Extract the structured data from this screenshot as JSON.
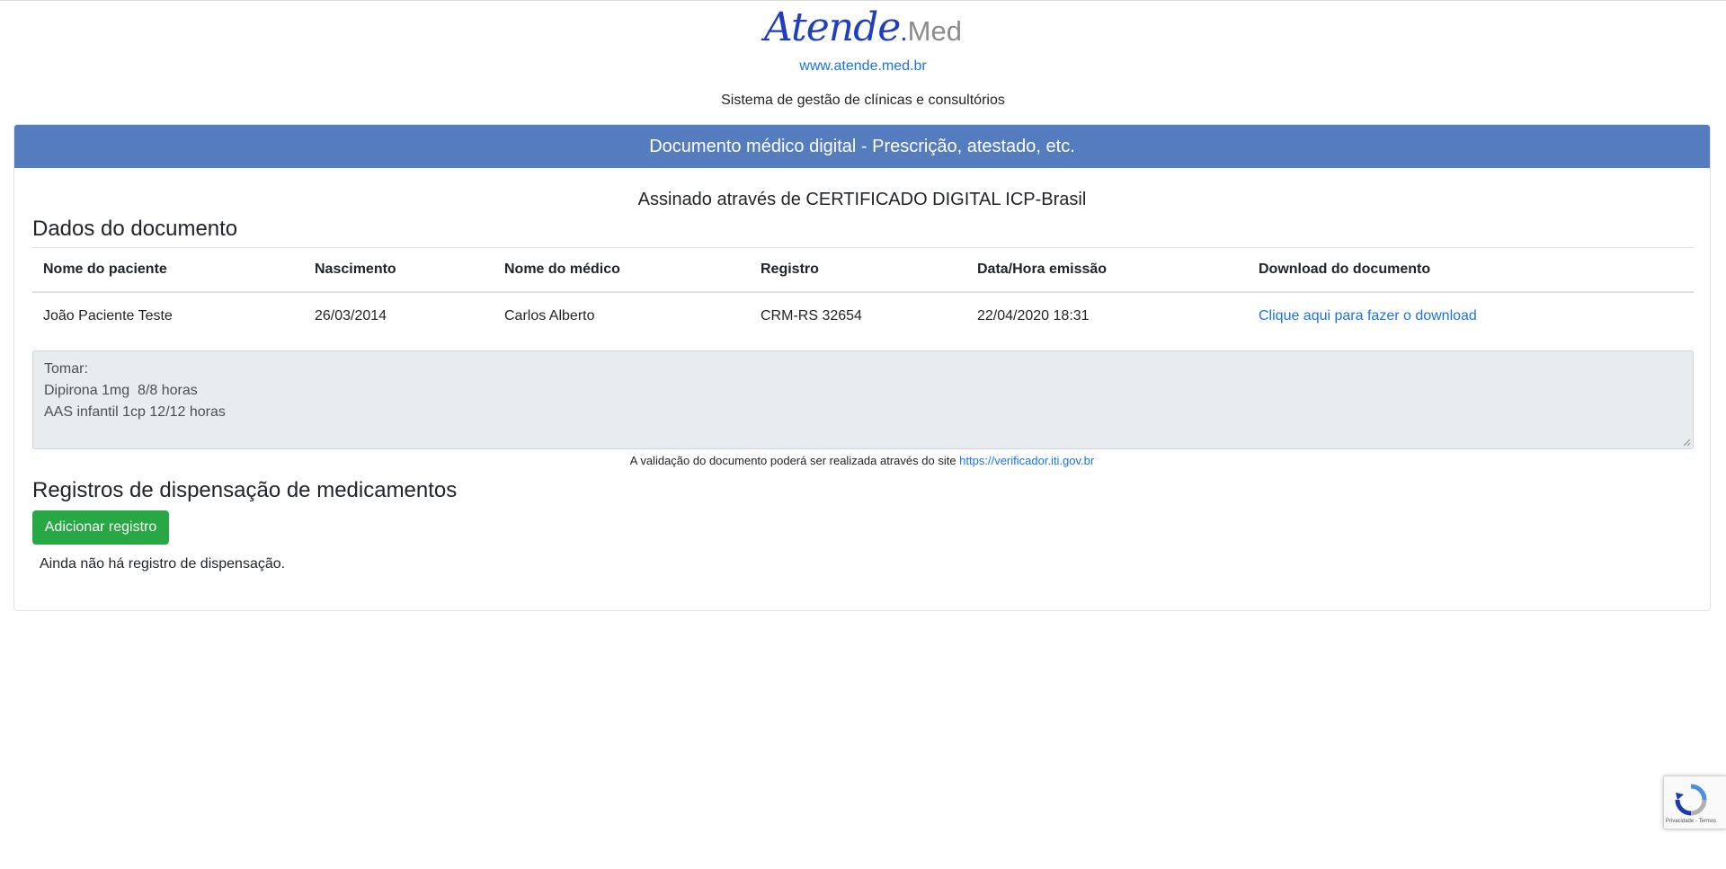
{
  "brand": {
    "logo_script": "Atende",
    "logo_dot": ".",
    "logo_med": "Med",
    "website": "www.atende.med.br",
    "tagline": "Sistema de gestão de clínicas e consultórios",
    "colors": {
      "script": "#1f3fbf",
      "med": "#8c8c8c",
      "link": "#1a73e8"
    }
  },
  "card": {
    "header_title": "Documento médico digital - Prescrição, atestado, etc.",
    "header_color": "#557cbf",
    "signed_text": "Assinado através de CERTIFICADO DIGITAL ICP-Brasil"
  },
  "document": {
    "section_title": "Dados do documento",
    "columns": [
      "Nome do paciente",
      "Nascimento",
      "Nome do médico",
      "Registro",
      "Data/Hora emissão",
      "Download do documento"
    ],
    "row": {
      "patient": "João Paciente Teste",
      "birth": "26/03/2014",
      "doctor": "Carlos Alberto",
      "registry": "CRM-RS 32654",
      "issued": "22/04/2020 18:31",
      "download_label": "Clique aqui para fazer o download"
    },
    "prescription_lines": [
      "Tomar:",
      "Dipirona 1mg  8/8 horas",
      "AAS infantil 1cp 12/12 horas"
    ],
    "validation_prefix": "A validação do documento poderá ser realizada através do site ",
    "validation_link": "https://verificador.iti.gov.br"
  },
  "dispensing": {
    "section_title": "Registros de dispensação de medicamentos",
    "add_button_label": "Adicionar registro",
    "add_button_color": "#28a745",
    "empty_message": "Ainda não há registro de dispensação."
  },
  "recaptcha": {
    "icon": "recaptcha-icon",
    "legal_text": "Privacidade - Termos"
  }
}
